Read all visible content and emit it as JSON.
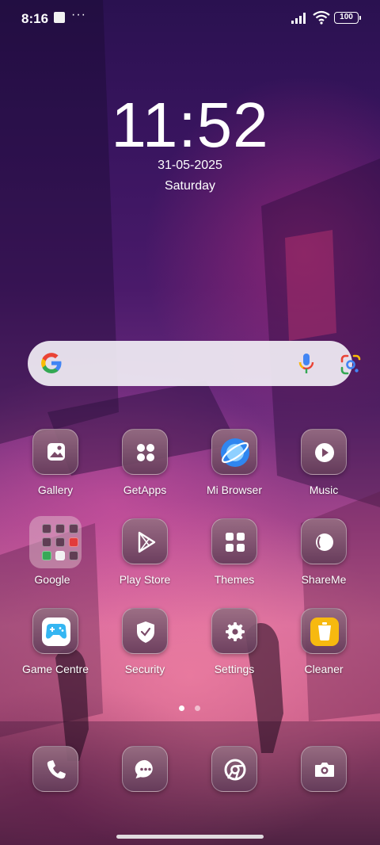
{
  "status_bar": {
    "time": "8:16",
    "overflow": "···",
    "battery": "100",
    "icons": [
      "notification-square-icon",
      "signal-icon",
      "wifi-icon",
      "battery-icon"
    ]
  },
  "clock": {
    "time": "11:52",
    "date": "31-05-2025",
    "day": "Saturday"
  },
  "search": {
    "icons": [
      "google-logo",
      "microphone-icon",
      "google-lens-icon"
    ]
  },
  "apps": [
    {
      "label": "Gallery",
      "icon": "gallery-icon"
    },
    {
      "label": "GetApps",
      "icon": "getapps-icon"
    },
    {
      "label": "Mi Browser",
      "icon": "mi-browser-icon"
    },
    {
      "label": "Music",
      "icon": "music-icon"
    },
    {
      "label": "Google",
      "icon": "google-folder-icon"
    },
    {
      "label": "Play Store",
      "icon": "play-store-icon"
    },
    {
      "label": "Themes",
      "icon": "themes-icon"
    },
    {
      "label": "ShareMe",
      "icon": "shareme-icon"
    },
    {
      "label": "Game Centre",
      "icon": "game-centre-icon"
    },
    {
      "label": "Security",
      "icon": "security-icon"
    },
    {
      "label": "Settings",
      "icon": "settings-icon"
    },
    {
      "label": "Cleaner",
      "icon": "cleaner-icon"
    }
  ],
  "page_indicator": {
    "pages": 2,
    "current": 1
  },
  "dock": [
    {
      "icon": "phone-icon"
    },
    {
      "icon": "messages-icon"
    },
    {
      "icon": "chrome-icon"
    },
    {
      "icon": "camera-icon"
    }
  ],
  "colors": {
    "mi_browser": "#2f86f0",
    "game_centre": "#35b6f2",
    "cleaner": "#f7b90f",
    "google_blue": "#4285f4",
    "google_red": "#ea4335",
    "google_yellow": "#fbbc05",
    "google_green": "#34a853"
  }
}
